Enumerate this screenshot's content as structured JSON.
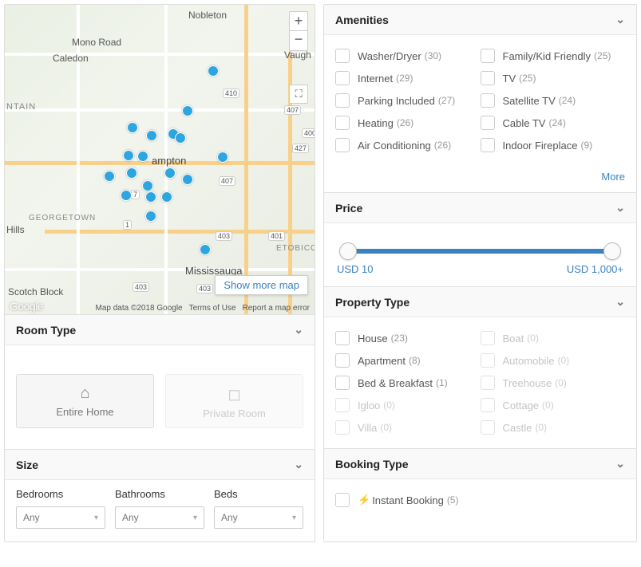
{
  "map": {
    "labels": {
      "nobleton": "Nobleton",
      "mono": "Mono Road",
      "caledon": "Caledon",
      "vaughan": "Vaugh",
      "ntain": "NTAIN",
      "ampton": "ampton",
      "georgetown": "GEORGETOWN",
      "hills": "Hills",
      "mississauga": "Mississauga",
      "etobicoke": "ETOBICO",
      "scotch": "Scotch Block"
    },
    "routes": {
      "r410": "410",
      "r407": "407",
      "r427": "427",
      "r400": "400",
      "r401": "401",
      "r403": "403",
      "r1": "1",
      "r7": "7"
    },
    "show_more": "Show more map",
    "attrib_data": "Map data ©2018 Google",
    "attrib_terms": "Terms of Use",
    "attrib_report": "Report a map error",
    "google": "Google",
    "zoom_in": "+",
    "zoom_out": "−",
    "full": "⛶"
  },
  "roomtype": {
    "title": "Room Type",
    "entire": "Entire Home",
    "private": "Private Room"
  },
  "size": {
    "title": "Size",
    "bedrooms": "Bedrooms",
    "bathrooms": "Bathrooms",
    "beds": "Beds",
    "any": "Any"
  },
  "amenities": {
    "title": "Amenities",
    "more": "More",
    "left": [
      {
        "label": "Washer/Dryer",
        "count": "(30)"
      },
      {
        "label": "Internet",
        "count": "(29)"
      },
      {
        "label": "Parking Included",
        "count": "(27)"
      },
      {
        "label": "Heating",
        "count": "(26)"
      },
      {
        "label": "Air Conditioning",
        "count": "(26)"
      }
    ],
    "right": [
      {
        "label": "Family/Kid Friendly",
        "count": "(25)"
      },
      {
        "label": "TV",
        "count": "(25)"
      },
      {
        "label": "Satellite TV",
        "count": "(24)"
      },
      {
        "label": "Cable TV",
        "count": "(24)"
      },
      {
        "label": "Indoor Fireplace",
        "count": "(9)"
      }
    ]
  },
  "price": {
    "title": "Price",
    "min": "USD 10",
    "max": "USD 1,000+"
  },
  "proptype": {
    "title": "Property Type",
    "left": [
      {
        "label": "House",
        "count": "(23)",
        "disabled": false
      },
      {
        "label": "Apartment",
        "count": "(8)",
        "disabled": false
      },
      {
        "label": "Bed & Breakfast",
        "count": "(1)",
        "disabled": false
      },
      {
        "label": "Igloo",
        "count": "(0)",
        "disabled": true
      },
      {
        "label": "Villa",
        "count": "(0)",
        "disabled": true
      }
    ],
    "right": [
      {
        "label": "Boat",
        "count": "(0)",
        "disabled": true
      },
      {
        "label": "Automobile",
        "count": "(0)",
        "disabled": true
      },
      {
        "label": "Treehouse",
        "count": "(0)",
        "disabled": true
      },
      {
        "label": "Cottage",
        "count": "(0)",
        "disabled": true
      },
      {
        "label": "Castle",
        "count": "(0)",
        "disabled": true
      }
    ]
  },
  "booking": {
    "title": "Booking Type",
    "instant": "Instant Booking",
    "instant_count": "(5)"
  }
}
